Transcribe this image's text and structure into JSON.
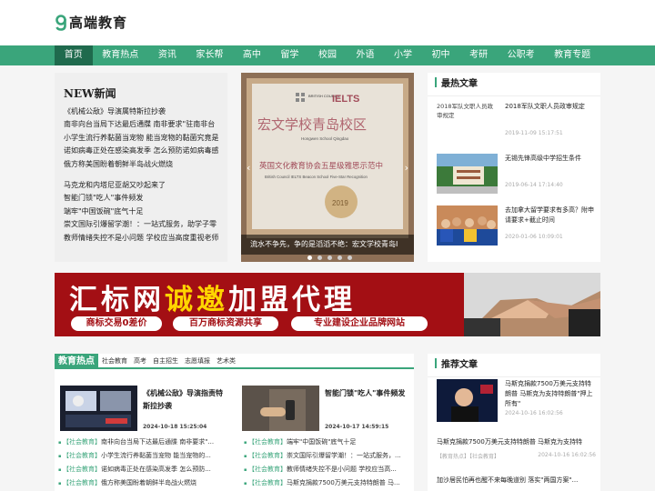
{
  "site": {
    "logo_text": "高端教育"
  },
  "nav": [
    "首页",
    "教育热点",
    "资讯",
    "家长帮",
    "高中",
    "留学",
    "校园",
    "外语",
    "小学",
    "初中",
    "考研",
    "公职考",
    "教育专题"
  ],
  "new_news": {
    "title": "NEW新闻",
    "group1": [
      "《机械公敌》导演属特斯拉抄袭",
      "南非向台当局下达最后通牒 南非要求\"驻南非台",
      "小学生流行养黏菌当宠物 能当宠物的黏菌究竟是",
      "诺如病毒正处在感染高发季 怎么预防诺如病毒感",
      "俄方称美国盼着朝鲜半岛战火燃烧"
    ],
    "group2": [
      "马克龙和内塔尼亚胡又吵起来了",
      "智能门锁\"吃人\"事件频发",
      "端牢\"中国饭碗\"底气十足",
      "崇文国际引爆留学潮！：一站式服务，助学子零",
      "教师情绪失控不是小问题 学校应当高度重视老师"
    ]
  },
  "slider": {
    "caption": "流水不争先，争的是滔滔不绝：宏文学校青岛I",
    "dot_count": 5,
    "active_dot": 0,
    "plaque_top": "IELTS",
    "plaque_school": "宏文学校青岛校区",
    "plaque_school_en": "Hongwen School Qingdao",
    "plaque_award": "英国文化教育协会五星级雅思示范中",
    "plaque_award_en": "British Council IELTS Beacon School Five-Star Recognition",
    "bc_logo": "BRITISH COUNCIL",
    "plaque_year": "2019"
  },
  "hot_articles": {
    "title": "最热文章",
    "items": [
      {
        "title": "2018军队文职人员政审规定",
        "date": "2019-11-09 15:17:51",
        "img_alt": "2018军队文职人员政审规定"
      },
      {
        "title": "无锡先锋高级中学招生条件",
        "date": "2019-06-14 17:14:40"
      },
      {
        "title": "去加拿大留学要求有多高？附申请要求+截止时间",
        "date": "2020-01-06 10:09:01"
      }
    ]
  },
  "banner": {
    "line1_a": "汇标网",
    "line1_b": "诚邀",
    "line1_c": "加盟代理",
    "pills": [
      "商标交易0差价",
      "百万商标资源共享",
      "专业建设企业品牌网站"
    ]
  },
  "edu_hot": {
    "tab": "教育热点",
    "links": [
      "社会教育",
      "高考",
      "自主招生",
      "志愿填报",
      "艺术类"
    ],
    "features": [
      {
        "title": "《机械公敌》导演指责特斯拉抄袭",
        "date": "2024-10-18 15:25:04"
      },
      {
        "title": "智能门锁\"吃人\"事件频发",
        "date": "2024-10-17 14:59:15"
      }
    ],
    "list_left": [
      {
        "tag": "【社会教育】",
        "text": "南非向台当局下达最后通牒 南非要求\"..."
      },
      {
        "tag": "【社会教育】",
        "text": "小学生流行养黏菌当宠物 能当宠物的..."
      },
      {
        "tag": "【社会教育】",
        "text": "诺如病毒正处在感染高发季 怎么预防..."
      },
      {
        "tag": "【社会教育】",
        "text": "俄方称美国盼着朝鲜半岛战火燃烧"
      }
    ],
    "list_right": [
      {
        "tag": "【社会教育】",
        "text": "端牢\"中国饭碗\"底气十足"
      },
      {
        "tag": "【社会教育】",
        "text": "崇文国际引爆留学潮！：一站式服务，..."
      },
      {
        "tag": "【社会教育】",
        "text": "教师情绪失控不是小问题 学校应当高..."
      },
      {
        "tag": "【社会教育】",
        "text": "马斯克捐款7500万美元支持特朗普 马..."
      }
    ]
  },
  "recommend": {
    "title": "推荐文章",
    "item": {
      "title": "马斯克捐款7500万美元支持特朗普 马斯克为支持特朗普\"押上所有\"",
      "date": "2024-10-16 16:02:56"
    },
    "line1": "马斯克捐款7500万美元支持特朗普 马斯克为支持特",
    "meta1_tags": "【教育热点】【社会教育】",
    "meta1_date": "2024-10-16 16:02:56",
    "line2": "加沙居民怕再也醒不来每晚道别 落实\"两国方案\"..."
  },
  "colors": {
    "brand": "#3aa57b",
    "nav_active": "#1f6a4d",
    "banner": "#a30f14"
  }
}
